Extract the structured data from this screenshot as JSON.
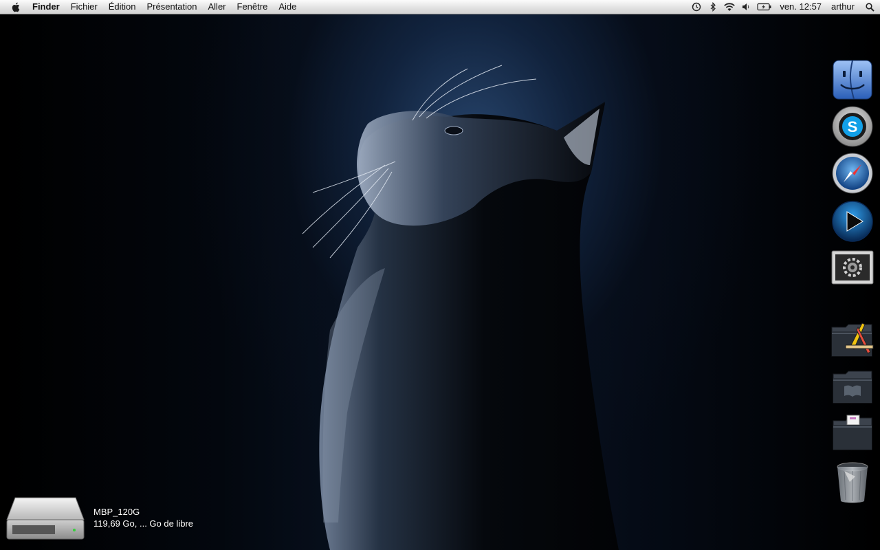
{
  "menubar": {
    "app_name": "Finder",
    "menus": [
      "Fichier",
      "Édition",
      "Présentation",
      "Aller",
      "Fenêtre",
      "Aide"
    ],
    "status_icons": [
      "time-machine-icon",
      "bluetooth-icon",
      "wifi-icon",
      "volume-icon",
      "battery-icon"
    ],
    "clock": "ven. 12:57",
    "user": "arthur"
  },
  "dock": {
    "items": [
      {
        "name": "finder-dock-icon"
      },
      {
        "name": "skype-dock-icon"
      },
      {
        "name": "safari-dock-icon"
      },
      {
        "name": "media-player-dock-icon"
      },
      {
        "name": "system-preferences-dock-icon"
      },
      {
        "name": "applications-folder-dock-icon"
      },
      {
        "name": "documents-folder-dock-icon"
      },
      {
        "name": "downloads-folder-dock-icon"
      },
      {
        "name": "trash-dock-icon"
      }
    ]
  },
  "desktop": {
    "volume_name": "MBP_120G",
    "volume_info": "119,69 Go, ... Go de libre"
  },
  "colors": {
    "menubar_top": "#fbfbfb",
    "menubar_bottom": "#d2d2d2",
    "wallpaper_accent": "#1e3a5f"
  }
}
